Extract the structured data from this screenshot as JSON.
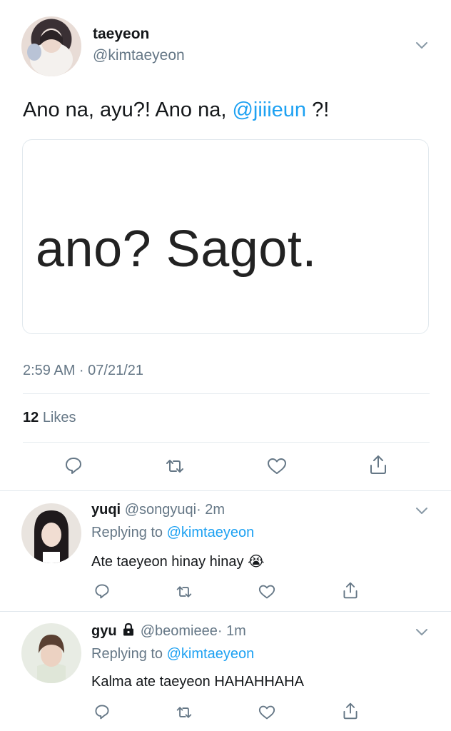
{
  "tweet": {
    "name": "taeyeon",
    "handle": "@kimtaeyeon",
    "text_before": "Ano na, ayu?! Ano na, ",
    "mention": "@jiiieun",
    "text_after": " ?!",
    "media_text": "ano? Sagot.",
    "time": "2:59 AM · 07/21/21",
    "likes_count": "12",
    "likes_label": "Likes"
  },
  "replies": [
    {
      "name": "yuqi",
      "handle": "@songyuqi",
      "time": "· 2m",
      "replying_prefix": "Replying to ",
      "replying_to": "@kimtaeyeon",
      "text": "Ate taeyeon hinay hinay",
      "emoji": "😭"
    },
    {
      "name": "gyu",
      "handle": "@beomieee",
      "time": "· 1m",
      "replying_prefix": "Replying to ",
      "replying_to": "@kimtaeyeon",
      "text": "Kalma ate taeyeon HAHAHHAHA"
    }
  ],
  "colors": {
    "accent": "#1da1f2",
    "muted": "#657786",
    "text": "#14171a"
  },
  "icons": [
    "chevron-down-icon",
    "reply-icon",
    "retweet-icon",
    "like-icon",
    "share-icon",
    "lock-icon"
  ]
}
